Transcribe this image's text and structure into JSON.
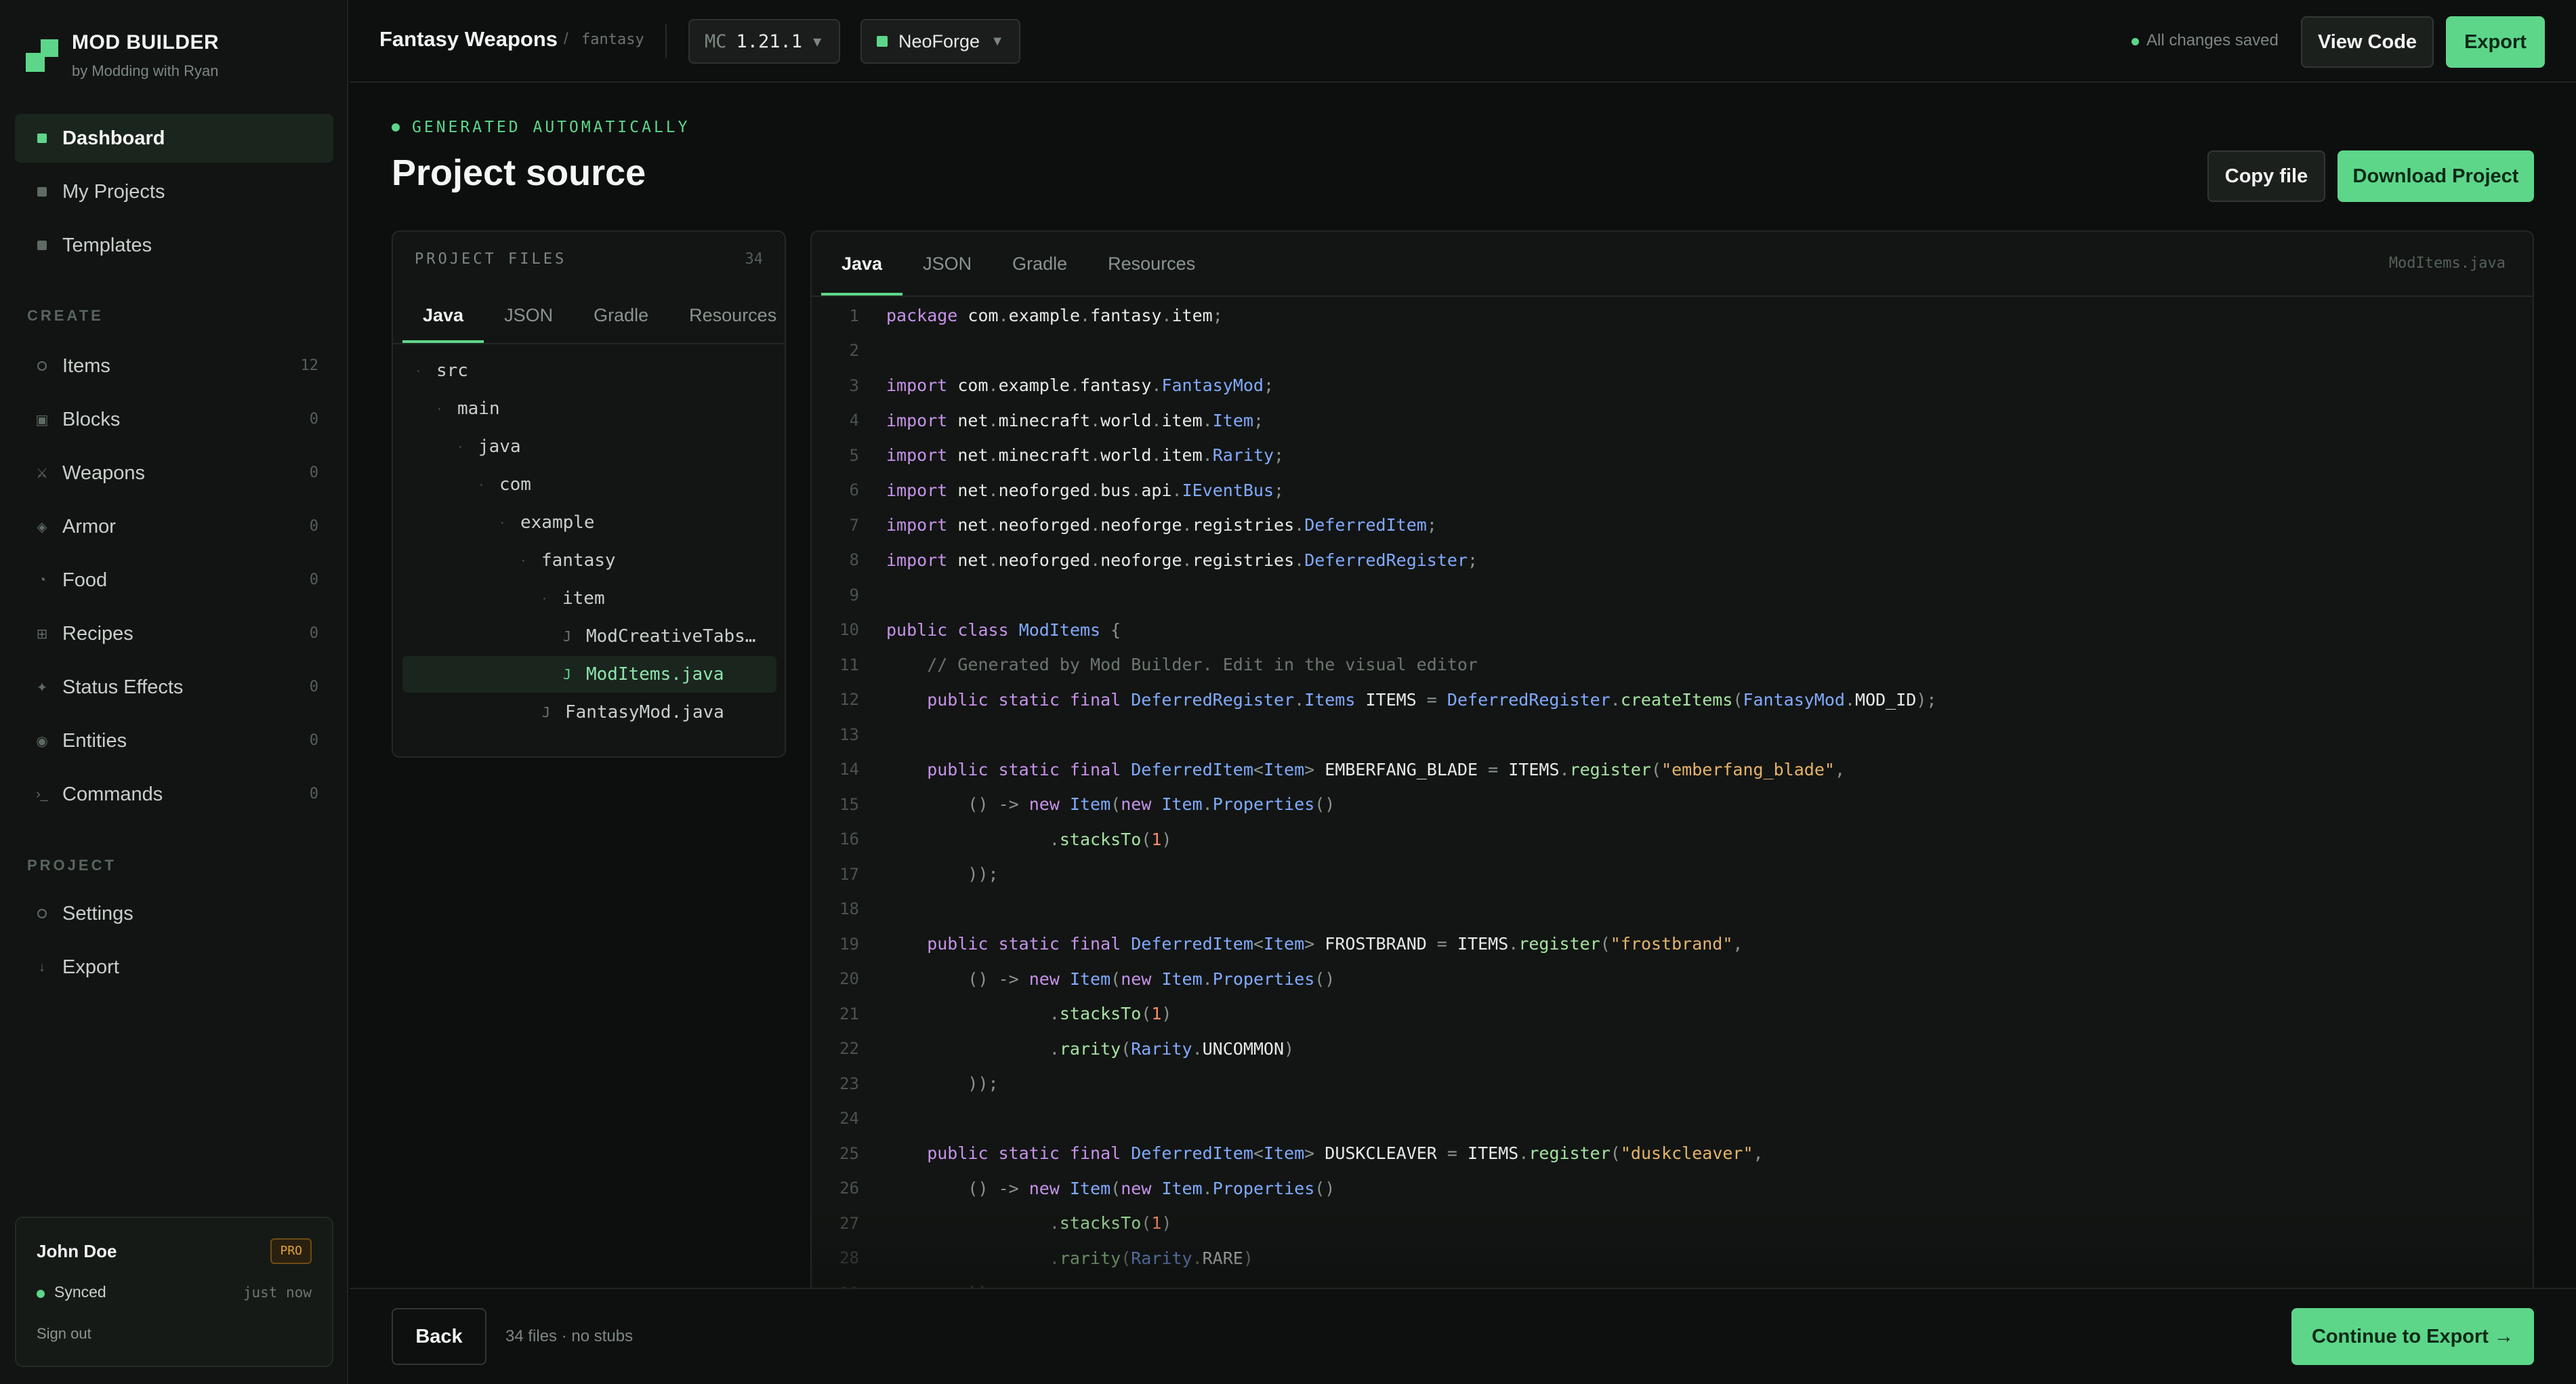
{
  "sidebar": {
    "brand": {
      "name": "MOD BUILDER",
      "subtitle": "by Modding with Ryan"
    },
    "main_items": [
      {
        "label": "Dashboard",
        "icon": "dashboard-icon",
        "active": true
      },
      {
        "label": "My Projects",
        "icon": "projects-icon"
      },
      {
        "label": "Templates",
        "icon": "templates-icon"
      }
    ],
    "create_label": "CREATE",
    "create_items": [
      {
        "label": "Items",
        "icon": "items-icon",
        "count": "12"
      },
      {
        "label": "Blocks",
        "icon": "blocks-icon",
        "count": "0"
      },
      {
        "label": "Weapons",
        "icon": "weapons-icon",
        "count": "0"
      },
      {
        "label": "Armor",
        "icon": "armor-icon",
        "count": "0"
      },
      {
        "label": "Food",
        "icon": "food-icon",
        "count": "0"
      },
      {
        "label": "Recipes",
        "icon": "recipes-icon",
        "count": "0"
      },
      {
        "label": "Status Effects",
        "icon": "status-effects-icon",
        "count": "0"
      },
      {
        "label": "Entities",
        "icon": "entities-icon",
        "count": "0"
      },
      {
        "label": "Commands",
        "icon": "commands-icon",
        "count": "0"
      }
    ],
    "project_label": "PROJECT",
    "project_items": [
      {
        "label": "Settings",
        "icon": "settings-icon"
      },
      {
        "label": "Export",
        "icon": "export-icon"
      }
    ],
    "user": {
      "name": "John Doe",
      "badge": "PRO",
      "status": "Synced",
      "status_time": "just now",
      "sign_out": "Sign out"
    }
  },
  "topbar": {
    "project_title": "Fantasy Weapons",
    "separator": "/",
    "namespace": "fantasy",
    "mc_label": "MC",
    "mc_version": "1.21.1",
    "loader": "NeoForge",
    "save_status": "All changes saved",
    "view_code": "View Code",
    "export": "Export"
  },
  "header": {
    "eyebrow": "GENERATED AUTOMATICALLY",
    "title": "Project source",
    "copy_file": "Copy file",
    "download": "Download Project"
  },
  "files": {
    "heading": "PROJECT FILES",
    "count": "34",
    "tabs": [
      "Java",
      "JSON",
      "Gradle",
      "Resources"
    ],
    "active_tab": 0,
    "tree": [
      {
        "label": "src",
        "type": "folder",
        "depth": 0
      },
      {
        "label": "main",
        "type": "folder",
        "depth": 1
      },
      {
        "label": "java",
        "type": "folder",
        "depth": 2
      },
      {
        "label": "com",
        "type": "folder",
        "depth": 3
      },
      {
        "label": "example",
        "type": "folder",
        "depth": 4
      },
      {
        "label": "fantasy",
        "type": "folder",
        "depth": 5
      },
      {
        "label": "item",
        "type": "folder",
        "depth": 6
      },
      {
        "label": "ModCreativeTabs…",
        "type": "file",
        "depth": 7
      },
      {
        "label": "ModItems.java",
        "type": "file",
        "depth": 7,
        "active": true
      },
      {
        "label": "FantasyMod.java",
        "type": "file",
        "depth": 6
      }
    ]
  },
  "code": {
    "tabs": [
      "Java",
      "JSON",
      "Gradle",
      "Resources"
    ],
    "active_tab": 0,
    "filename": "ModItems.java",
    "lines": [
      [
        [
          "kw",
          "package"
        ],
        [
          "",
          "com"
        ],
        [
          "pu",
          "."
        ],
        [
          "",
          "example"
        ],
        [
          "pu",
          "."
        ],
        [
          "",
          "fantasy"
        ],
        [
          "pu",
          "."
        ],
        [
          "",
          "item"
        ],
        [
          "pu",
          ";"
        ]
      ],
      [],
      [
        [
          "kw",
          "import"
        ],
        [
          "",
          "com"
        ],
        [
          "pu",
          "."
        ],
        [
          "",
          "example"
        ],
        [
          "pu",
          "."
        ],
        [
          "",
          "fantasy"
        ],
        [
          "pu",
          "."
        ],
        [
          "ty",
          "FantasyMod"
        ],
        [
          "pu",
          ";"
        ]
      ],
      [
        [
          "kw",
          "import"
        ],
        [
          "",
          "net"
        ],
        [
          "pu",
          "."
        ],
        [
          "",
          "minecraft"
        ],
        [
          "pu",
          "."
        ],
        [
          "",
          "world"
        ],
        [
          "pu",
          "."
        ],
        [
          "",
          "item"
        ],
        [
          "pu",
          "."
        ],
        [
          "ty",
          "Item"
        ],
        [
          "pu",
          ";"
        ]
      ],
      [
        [
          "kw",
          "import"
        ],
        [
          "",
          "net"
        ],
        [
          "pu",
          "."
        ],
        [
          "",
          "minecraft"
        ],
        [
          "pu",
          "."
        ],
        [
          "",
          "world"
        ],
        [
          "pu",
          "."
        ],
        [
          "",
          "item"
        ],
        [
          "pu",
          "."
        ],
        [
          "ty",
          "Rarity"
        ],
        [
          "pu",
          ";"
        ]
      ],
      [
        [
          "kw",
          "import"
        ],
        [
          "",
          "net"
        ],
        [
          "pu",
          "."
        ],
        [
          "",
          "neoforged"
        ],
        [
          "pu",
          "."
        ],
        [
          "",
          "bus"
        ],
        [
          "pu",
          "."
        ],
        [
          "",
          "api"
        ],
        [
          "pu",
          "."
        ],
        [
          "ty",
          "IEventBus"
        ],
        [
          "pu",
          ";"
        ]
      ],
      [
        [
          "kw",
          "import"
        ],
        [
          "",
          "net"
        ],
        [
          "pu",
          "."
        ],
        [
          "",
          "neoforged"
        ],
        [
          "pu",
          "."
        ],
        [
          "",
          "neoforge"
        ],
        [
          "pu",
          "."
        ],
        [
          "",
          "registries"
        ],
        [
          "pu",
          "."
        ],
        [
          "ty",
          "DeferredItem"
        ],
        [
          "pu",
          ";"
        ]
      ],
      [
        [
          "kw",
          "import"
        ],
        [
          "",
          "net"
        ],
        [
          "pu",
          "."
        ],
        [
          "",
          "neoforged"
        ],
        [
          "pu",
          "."
        ],
        [
          "",
          "neoforge"
        ],
        [
          "pu",
          "."
        ],
        [
          "",
          "registries"
        ],
        [
          "pu",
          "."
        ],
        [
          "ty",
          "DeferredRegister"
        ],
        [
          "pu",
          ";"
        ]
      ],
      [],
      [
        [
          "kw",
          "public class"
        ],
        [
          "ty",
          "ModItems"
        ],
        [
          "pu",
          "{"
        ]
      ],
      [
        [
          "cm",
          "    // Generated by Mod Builder. Edit in the visual editor"
        ]
      ],
      [
        [
          "kw",
          "    public static final"
        ],
        [
          "ty",
          "DeferredRegister"
        ],
        [
          "pu",
          "."
        ],
        [
          "ty",
          "Items"
        ],
        [
          "",
          "ITEMS"
        ],
        [
          "pu",
          "="
        ],
        [
          "ty",
          "DeferredRegister"
        ],
        [
          "pu",
          "."
        ],
        [
          "fn",
          "createItems"
        ],
        [
          "pu",
          "("
        ],
        [
          "ty",
          "FantasyMod"
        ],
        [
          "pu",
          "."
        ],
        [
          "",
          "MOD_ID"
        ],
        [
          "pu",
          ");"
        ]
      ],
      [],
      [
        [
          "kw",
          "    public static final"
        ],
        [
          "ty",
          "DeferredItem"
        ],
        [
          "pu",
          "<"
        ],
        [
          "ty",
          "Item"
        ],
        [
          "pu",
          ">"
        ],
        [
          "",
          "EMBERFANG_BLADE"
        ],
        [
          "pu",
          "="
        ],
        [
          "",
          "ITEMS"
        ],
        [
          "pu",
          "."
        ],
        [
          "fn",
          "register"
        ],
        [
          "pu",
          "("
        ],
        [
          "st",
          "\"emberfang_blade\""
        ],
        [
          "pu",
          ","
        ]
      ],
      [
        [
          "pu",
          "        () ->"
        ],
        [
          "kw",
          "new"
        ],
        [
          "ty",
          "Item"
        ],
        [
          "pu",
          "("
        ],
        [
          "kw",
          "new"
        ],
        [
          "ty",
          "Item"
        ],
        [
          "pu",
          "."
        ],
        [
          "ty",
          "Properties"
        ],
        [
          "pu",
          "()"
        ]
      ],
      [
        [
          "pu",
          "                ."
        ],
        [
          "fn",
          "stacksTo"
        ],
        [
          "pu",
          "("
        ],
        [
          "nu",
          "1"
        ],
        [
          "pu",
          ")"
        ]
      ],
      [
        [
          "pu",
          "        ));"
        ]
      ],
      [],
      [
        [
          "kw",
          "    public static final"
        ],
        [
          "ty",
          "DeferredItem"
        ],
        [
          "pu",
          "<"
        ],
        [
          "ty",
          "Item"
        ],
        [
          "pu",
          ">"
        ],
        [
          "",
          "FROSTBRAND"
        ],
        [
          "pu",
          "="
        ],
        [
          "",
          "ITEMS"
        ],
        [
          "pu",
          "."
        ],
        [
          "fn",
          "register"
        ],
        [
          "pu",
          "("
        ],
        [
          "st",
          "\"frostbrand\""
        ],
        [
          "pu",
          ","
        ]
      ],
      [
        [
          "pu",
          "        () ->"
        ],
        [
          "kw",
          "new"
        ],
        [
          "ty",
          "Item"
        ],
        [
          "pu",
          "("
        ],
        [
          "kw",
          "new"
        ],
        [
          "ty",
          "Item"
        ],
        [
          "pu",
          "."
        ],
        [
          "ty",
          "Properties"
        ],
        [
          "pu",
          "()"
        ]
      ],
      [
        [
          "pu",
          "                ."
        ],
        [
          "fn",
          "stacksTo"
        ],
        [
          "pu",
          "("
        ],
        [
          "nu",
          "1"
        ],
        [
          "pu",
          ")"
        ]
      ],
      [
        [
          "pu",
          "                ."
        ],
        [
          "fn",
          "rarity"
        ],
        [
          "pu",
          "("
        ],
        [
          "ty",
          "Rarity"
        ],
        [
          "pu",
          "."
        ],
        [
          "",
          "UNCOMMON"
        ],
        [
          "pu",
          ")"
        ]
      ],
      [
        [
          "pu",
          "        ));"
        ]
      ],
      [],
      [
        [
          "kw",
          "    public static final"
        ],
        [
          "ty",
          "DeferredItem"
        ],
        [
          "pu",
          "<"
        ],
        [
          "ty",
          "Item"
        ],
        [
          "pu",
          ">"
        ],
        [
          "",
          "DUSKCLEAVER"
        ],
        [
          "pu",
          "="
        ],
        [
          "",
          "ITEMS"
        ],
        [
          "pu",
          "."
        ],
        [
          "fn",
          "register"
        ],
        [
          "pu",
          "("
        ],
        [
          "st",
          "\"duskcleaver\""
        ],
        [
          "pu",
          ","
        ]
      ],
      [
        [
          "pu",
          "        () ->"
        ],
        [
          "kw",
          "new"
        ],
        [
          "ty",
          "Item"
        ],
        [
          "pu",
          "("
        ],
        [
          "kw",
          "new"
        ],
        [
          "ty",
          "Item"
        ],
        [
          "pu",
          "."
        ],
        [
          "ty",
          "Properties"
        ],
        [
          "pu",
          "()"
        ]
      ],
      [
        [
          "pu",
          "                ."
        ],
        [
          "fn",
          "stacksTo"
        ],
        [
          "pu",
          "("
        ],
        [
          "nu",
          "1"
        ],
        [
          "pu",
          ")"
        ]
      ],
      [
        [
          "pu",
          "                ."
        ],
        [
          "fn",
          "rarity"
        ],
        [
          "pu",
          "("
        ],
        [
          "ty",
          "Rarity"
        ],
        [
          "pu",
          "."
        ],
        [
          "",
          "RARE"
        ],
        [
          "pu",
          ")"
        ]
      ],
      [
        [
          "pu",
          "        ));"
        ]
      ]
    ]
  },
  "footer": {
    "back": "Back",
    "note": "34 files · no stubs",
    "continue": "Continue to Export →"
  }
}
